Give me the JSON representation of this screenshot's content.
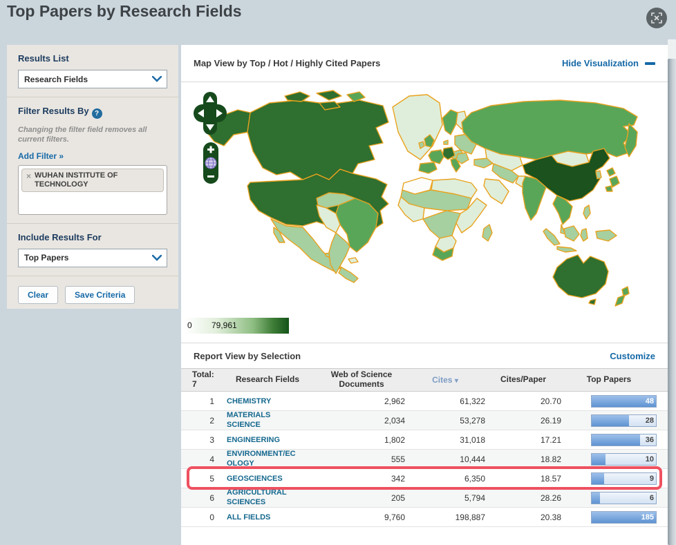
{
  "header": {
    "title": "Top Papers by Research Fields"
  },
  "sidebar": {
    "results_list": {
      "label": "Results List",
      "selected": "Research Fields"
    },
    "filter": {
      "label": "Filter Results By",
      "help": "?",
      "note": "Changing the filter field removes all current filters.",
      "add_filter": "Add Filter »",
      "chip": {
        "remove": "×",
        "label": "WUHAN INSTITUTE OF TECHNOLOGY"
      }
    },
    "include": {
      "label": "Include Results For",
      "selected": "Top Papers"
    },
    "buttons": {
      "clear": "Clear",
      "save": "Save Criteria"
    }
  },
  "map": {
    "title": "Map View by  Top / Hot / Highly Cited Papers",
    "hide_link": "Hide Visualization",
    "legend": {
      "min": "0",
      "max": "79,961"
    },
    "controls": {
      "zoom_in": "+",
      "zoom_out": "−"
    }
  },
  "report": {
    "title": "Report View by Selection",
    "customize": "Customize",
    "table": {
      "total_label": "Total:",
      "total_value": "7",
      "col_field": "Research Fields",
      "col_docs": "Web of Science Documents",
      "col_cites": "Cites",
      "col_cites_caret": "▾",
      "col_cpp": "Cites/Paper",
      "col_top": "Top Papers",
      "rows": [
        {
          "rank": "1",
          "field": "CHEMISTRY",
          "docs": "2,962",
          "cites": "61,322",
          "cpp": "20.70",
          "top": "48",
          "fill_pct": 100,
          "full": true,
          "highlighted": false
        },
        {
          "rank": "2",
          "field": "MATERIALS SCIENCE",
          "docs": "2,034",
          "cites": "53,278",
          "cpp": "26.19",
          "top": "28",
          "fill_pct": 58,
          "full": false,
          "highlighted": false
        },
        {
          "rank": "3",
          "field": "ENGINEERING",
          "docs": "1,802",
          "cites": "31,018",
          "cpp": "17.21",
          "top": "36",
          "fill_pct": 75,
          "full": false,
          "highlighted": false
        },
        {
          "rank": "4",
          "field": "ENVIRONMENT/ECOLOGY",
          "docs": "555",
          "cites": "10,444",
          "cpp": "18.82",
          "top": "10",
          "fill_pct": 21,
          "full": false,
          "highlighted": false
        },
        {
          "rank": "5",
          "field": "GEOSCIENCES",
          "docs": "342",
          "cites": "6,350",
          "cpp": "18.57",
          "top": "9",
          "fill_pct": 19,
          "full": false,
          "highlighted": true
        },
        {
          "rank": "6",
          "field": "AGRICULTURAL SCIENCES",
          "docs": "205",
          "cites": "5,794",
          "cpp": "28.26",
          "top": "6",
          "fill_pct": 13,
          "full": false,
          "highlighted": false
        },
        {
          "rank": "0",
          "field": "ALL FIELDS",
          "docs": "9,760",
          "cites": "198,887",
          "cpp": "20.38",
          "top": "185",
          "fill_pct": 100,
          "full": true,
          "highlighted": false
        }
      ]
    }
  },
  "colors": {
    "link_blue": "#1569a7",
    "sorted_column_blue": "#7d9cc4",
    "field_link_blue": "#15688e",
    "highlight_red": "#ee5160",
    "map_border_orange": "#e9a21e",
    "map_green_darkest": "#1b521d",
    "map_green_dark": "#2f6f2f",
    "map_green_medium": "#59a659",
    "map_green_light": "#a6d0a0",
    "map_green_pale": "#dfeeda",
    "bar_fill_blue": "#5f93d2",
    "sidebar_bg": "#e9e6e1",
    "header_band_bg": "#cbd5dc"
  }
}
